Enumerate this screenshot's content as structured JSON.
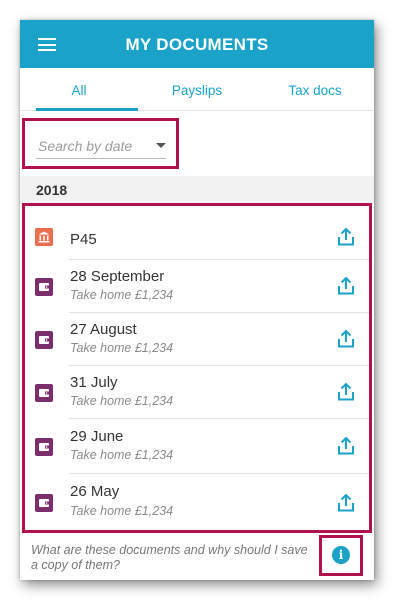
{
  "appbar": {
    "title": "MY DOCUMENTS",
    "menu_icon": "hamburger-menu-icon"
  },
  "tabs": [
    {
      "label": "All",
      "active": true
    },
    {
      "label": "Payslips",
      "active": false
    },
    {
      "label": "Tax docs",
      "active": false
    }
  ],
  "search": {
    "placeholder": "Search by date"
  },
  "year": "2018",
  "documents": [
    {
      "title": "P45",
      "subtitle": "",
      "icon": "bank-icon"
    },
    {
      "title": "28 September",
      "subtitle": "Take home £1,234",
      "icon": "wallet-icon"
    },
    {
      "title": "27 August",
      "subtitle": "Take home £1,234",
      "icon": "wallet-icon"
    },
    {
      "title": "31 July",
      "subtitle": "Take home £1,234",
      "icon": "wallet-icon"
    },
    {
      "title": "29 June",
      "subtitle": "Take home £1,234",
      "icon": "wallet-icon"
    },
    {
      "title": "26 May",
      "subtitle": "Take home £1,234",
      "icon": "wallet-icon"
    }
  ],
  "footer": {
    "text": "What are these documents and why should I save a copy of them?",
    "info_icon": "info-icon"
  },
  "colors": {
    "primary": "#1aa2c8",
    "highlight": "#b0124e",
    "bank_icon": "#ea6d4f",
    "wallet_icon": "#7b2d6c"
  }
}
